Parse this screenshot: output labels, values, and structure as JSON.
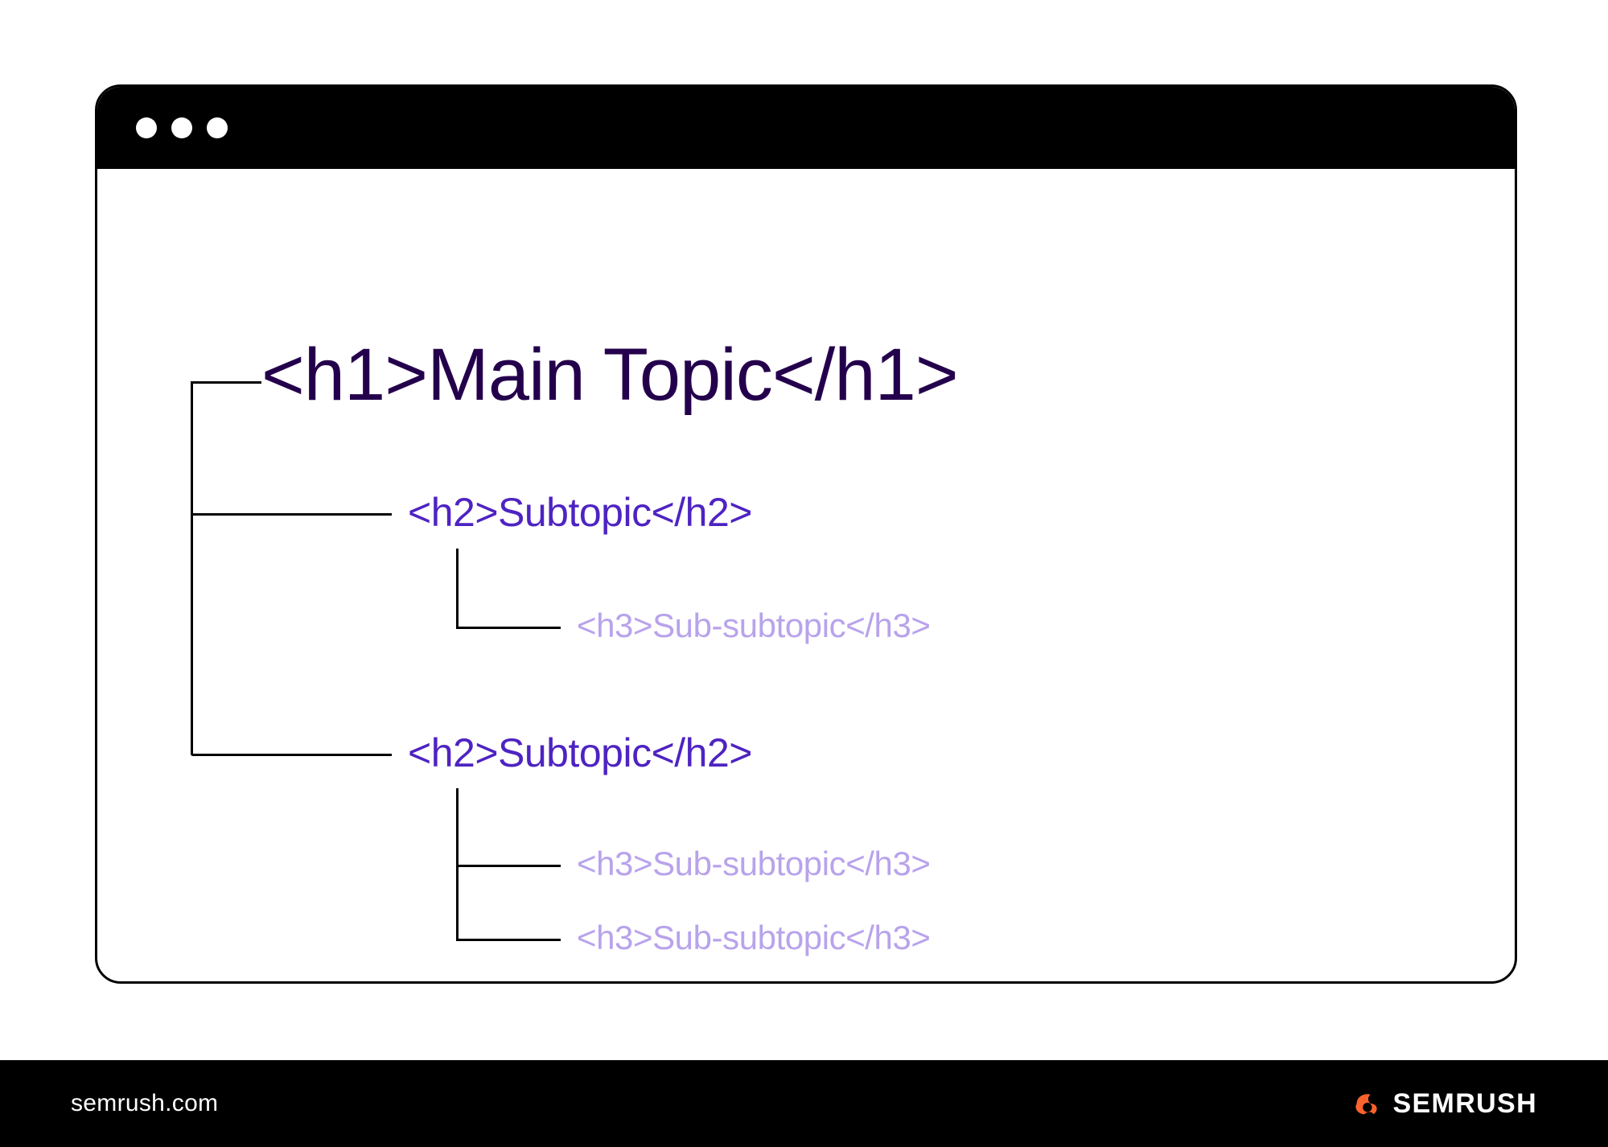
{
  "headings": {
    "h1": "<h1>Main Topic</h1>",
    "h2_1": "<h2>Subtopic</h2>",
    "h3_1": "<h3>Sub-subtopic</h3>",
    "h2_2": "<h2>Subtopic</h2>",
    "h3_2": "<h3>Sub-subtopic</h3>",
    "h3_3": "<h3>Sub-subtopic</h3>"
  },
  "footer": {
    "url": "semrush.com",
    "brand": "SEMRUSH"
  },
  "colors": {
    "h1": "#24004C",
    "h2": "#4E23C2",
    "h3": "#B8A3EC",
    "brand_accent": "#FF622D"
  }
}
